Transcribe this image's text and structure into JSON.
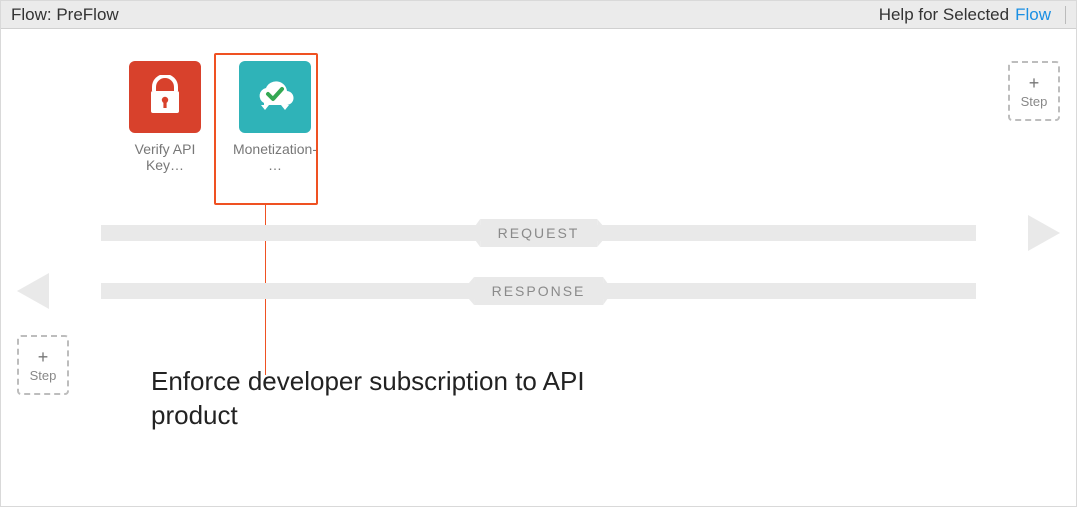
{
  "header": {
    "title": "Flow: PreFlow",
    "help_label": "Help for Selected",
    "help_link_label": "Flow"
  },
  "policies": [
    {
      "label": "Verify API Key…",
      "icon": "lock",
      "color": "red"
    },
    {
      "label": "Monetization-…",
      "icon": "cloud-check",
      "color": "teal",
      "selected": true
    }
  ],
  "lanes": {
    "request": "REQUEST",
    "response": "RESPONSE"
  },
  "add_step": {
    "plus": "+",
    "label": "Step"
  },
  "annotation": "Enforce developer subscription to API product"
}
